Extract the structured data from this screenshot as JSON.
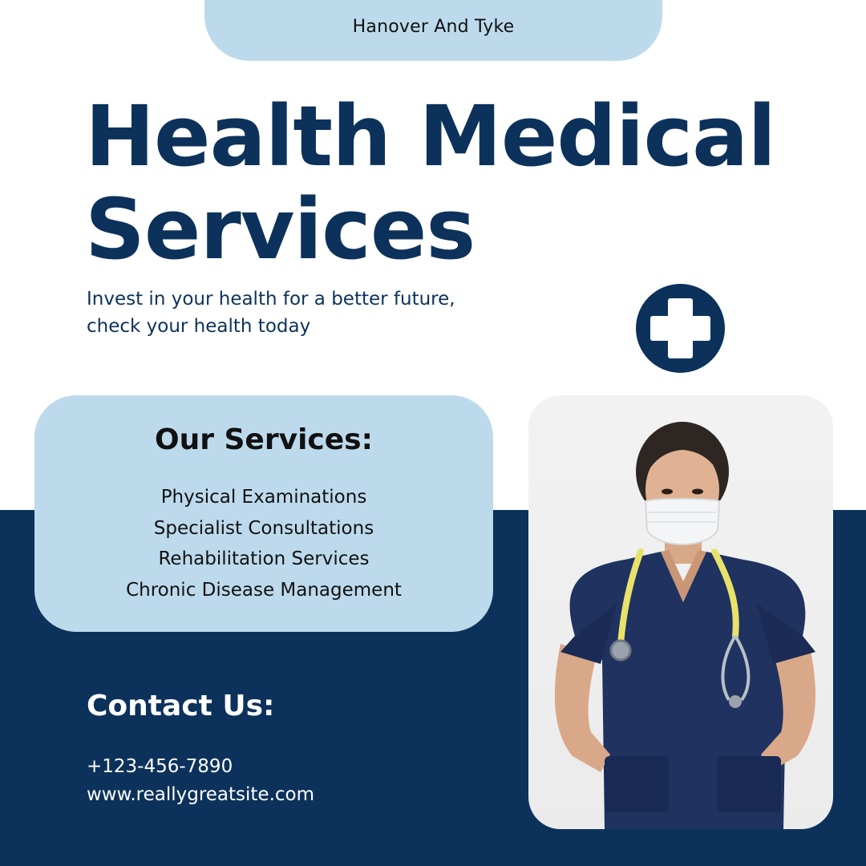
{
  "brand": {
    "name": "Hanover And Tyke"
  },
  "hero": {
    "title_line1": "Health Medical",
    "title_line2": "Services",
    "tagline_line1": "Invest in your health for a better future,",
    "tagline_line2": "check your health today"
  },
  "badge": {
    "icon": "medical-cross-icon"
  },
  "services": {
    "title": "Our Services:",
    "items": [
      "Physical Examinations",
      "Specialist Consultations",
      "Rehabilitation Services",
      "Chronic Disease Management"
    ]
  },
  "contact": {
    "title": "Contact Us:",
    "phone": "+123-456-7890",
    "website": "www.reallygreatsite.com"
  },
  "photo": {
    "subject": "nurse-with-stethoscope"
  },
  "colors": {
    "navy": "#0c325b",
    "light_blue": "#bddaed",
    "white": "#ffffff",
    "text_dark": "#111111",
    "stethoscope_yellow": "#e8e26a"
  }
}
